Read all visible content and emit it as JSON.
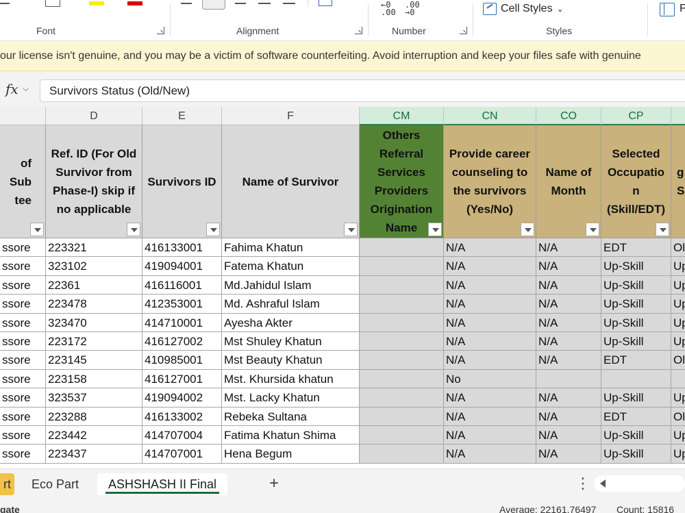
{
  "ribbon": {
    "groups": {
      "font": "Font",
      "alignment": "Alignment",
      "number": "Number",
      "styles": "Styles"
    },
    "cell_styles_label": "Cell Styles",
    "increase_decimal": "←0\n.00",
    "decrease_decimal": ".00\n→0",
    "right_partial_label": "F",
    "colors": {
      "highlight": "#ffeb00",
      "font_color": "#e00000"
    }
  },
  "warning": {
    "text": "our license isn't genuine, and you may be a victim of software counterfeiting. Avoid interruption and keep your files safe with genuine"
  },
  "formula_bar": {
    "fx_label": "fx",
    "value": "Survivors Status (Old/New)"
  },
  "columns": {
    "letters": [
      "D",
      "E",
      "F",
      "CM",
      "CN",
      "CO",
      "CP"
    ],
    "headers": {
      "c": "of Sub\ntee",
      "d": "Ref. ID (For Old Survivor from Phase-I) skip if no applicable",
      "e": "Survivors ID",
      "f": "Name of Survivor",
      "cm": "Others Referral Services Providers Origination Name",
      "cn": "Provide career counseling to the survivors (Yes/No)",
      "co": "Name of Month",
      "cp": "Selected Occupatio n (Skill/EDT)",
      "cq": "g\nSu"
    }
  },
  "rows": [
    {
      "c": "ssore",
      "d": "223321",
      "e": "416133001",
      "f": "Fahima Khatun",
      "cm": "",
      "cn": "N/A",
      "co": "N/A",
      "cp": "EDT",
      "cq": "Ol"
    },
    {
      "c": "ssore",
      "d": "323102",
      "e": "419094001",
      "f": "Fatema Khatun",
      "cm": "",
      "cn": "N/A",
      "co": "N/A",
      "cp": "Up-Skill",
      "cq": "Up"
    },
    {
      "c": "ssore",
      "d": "22361",
      "e": "416116001",
      "f": "Md.Jahidul Islam",
      "cm": "",
      "cn": "N/A",
      "co": "N/A",
      "cp": "Up-Skill",
      "cq": "Up"
    },
    {
      "c": "ssore",
      "d": "223478",
      "e": "412353001",
      "f": "Md. Ashraful Islam",
      "cm": "",
      "cn": "N/A",
      "co": "N/A",
      "cp": "Up-Skill",
      "cq": "Up"
    },
    {
      "c": "ssore",
      "d": "323470",
      "e": "414710001",
      "f": "Ayesha Akter",
      "cm": "",
      "cn": "N/A",
      "co": "N/A",
      "cp": "Up-Skill",
      "cq": "Up"
    },
    {
      "c": "ssore",
      "d": "223172",
      "e": "416127002",
      "f": "Mst Shuley Khatun",
      "cm": "",
      "cn": "N/A",
      "co": "N/A",
      "cp": "Up-Skill",
      "cq": "Up"
    },
    {
      "c": "ssore",
      "d": "223145",
      "e": "410985001",
      "f": "Mst Beauty Khatun",
      "cm": "",
      "cn": "N/A",
      "co": "N/A",
      "cp": "EDT",
      "cq": "Ol"
    },
    {
      "c": "ssore",
      "d": "223158",
      "e": "416127001",
      "f": "Mst. Khursida khatun",
      "cm": "",
      "cn": "No",
      "co": "",
      "cp": "",
      "cq": ""
    },
    {
      "c": "ssore",
      "d": "323537",
      "e": "419094002",
      "f": "Mst. Lacky Khatun",
      "cm": "",
      "cn": "N/A",
      "co": "N/A",
      "cp": "Up-Skill",
      "cq": "Up"
    },
    {
      "c": "ssore",
      "d": "223288",
      "e": "416133002",
      "f": "Rebeka Sultana",
      "cm": "",
      "cn": "N/A",
      "co": "N/A",
      "cp": "EDT",
      "cq": "Ol"
    },
    {
      "c": "ssore",
      "d": "223442",
      "e": "414707004",
      "f": "Fatima Khatun Shima",
      "cm": "",
      "cn": "N/A",
      "co": "N/A",
      "cp": "Up-Skill",
      "cq": "Up"
    },
    {
      "c": "ssore",
      "d": "223437",
      "e": "414707001",
      "f": "Hena Begum",
      "cm": "",
      "cn": "N/A",
      "co": "N/A",
      "cp": "Up-Skill",
      "cq": "Up"
    }
  ],
  "sheet_tabs": {
    "prev_partial": "rt",
    "eco_part": "Eco Part",
    "active": "ASHSHASH II Final",
    "add": "+"
  },
  "status_bar": {
    "left": "gate",
    "average": "Average: 22161.76497",
    "count": "Count: 15816"
  }
}
